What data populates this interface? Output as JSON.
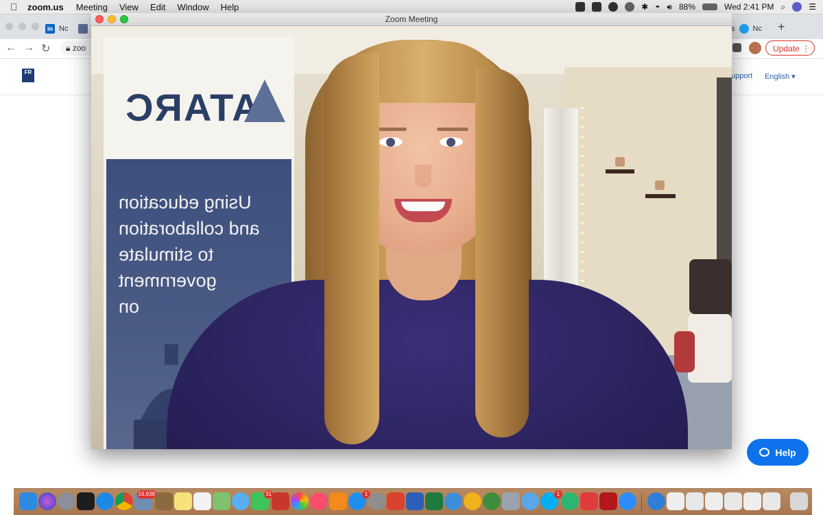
{
  "menubar": {
    "app_name": "zoom.us",
    "menus": [
      "Meeting",
      "View",
      "Edit",
      "Window",
      "Help"
    ],
    "battery": "88%",
    "clock": "Wed 2:41 PM"
  },
  "browser": {
    "tab_left_label": "Nc",
    "tab_right_label": "Nc",
    "tab_right_prefix": "s",
    "new_tab": "+",
    "url": "zoo",
    "update_label": "Update",
    "update_dots": "⋮",
    "support_link": "upport",
    "language": "English ▾",
    "help_button": "Help"
  },
  "zoom": {
    "window_title": "Zoom Meeting",
    "banner_brand": "ATARC",
    "banner_lines": [
      "Using education",
      "and collaboration",
      "to stimulate",
      "government",
      "on"
    ]
  },
  "dock": {
    "badge_mail": "16,938",
    "badge_messages": "31",
    "badge_appstore": "1",
    "badge_skype": "1"
  },
  "colors": {
    "help_blue": "#0e72ed",
    "update_red": "#d93025",
    "sweater_purple": "#2e2562",
    "banner_blue": "#4a5b85"
  }
}
